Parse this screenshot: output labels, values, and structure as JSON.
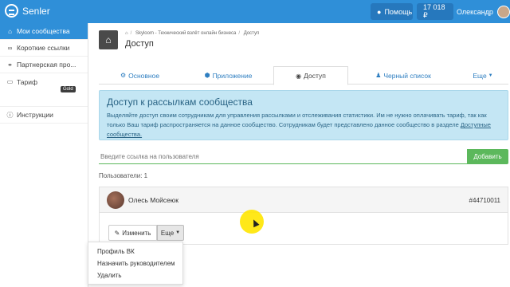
{
  "app": {
    "name": "Senler"
  },
  "topbar": {
    "help_label": "Помощь",
    "balance": "17 018 ₽",
    "user_name": "Олександр"
  },
  "sidebar": {
    "items": [
      {
        "label": "Мои сообщества",
        "icon": "home-icon"
      },
      {
        "label": "Короткие ссылки",
        "icon": "link-icon"
      },
      {
        "label": "Партнерская про...",
        "icon": "partner-icon"
      },
      {
        "label": "Тариф",
        "icon": "card-icon",
        "badge": "Gold"
      },
      {
        "label": "Инструкции",
        "icon": "info-icon"
      }
    ],
    "gold_badge": "Gold"
  },
  "header": {
    "breadcrumb": [
      "Skyloom - Технический взлёт онлайн бизнеса",
      "Доступ"
    ],
    "title": "Доступ"
  },
  "tabs": [
    {
      "label": "Основное",
      "icon": "gears-icon"
    },
    {
      "label": "Приложение",
      "icon": "cubes-icon"
    },
    {
      "label": "Доступ",
      "icon": "eye-icon"
    },
    {
      "label": "Черный список",
      "icon": "user-block-icon"
    },
    {
      "label": "Еще",
      "icon": "caret-down-icon"
    }
  ],
  "info": {
    "title": "Доступ к рассылкам сообщества",
    "text": "Выделяйте доступ своим сотрудникам для управления рассылками и отслеживания статистики. Им не нужно оплачивать тариф, так как только Ваш тариф распространяется на данное сообщество. Сотрудникам будет представлено данное сообщество в разделе ",
    "link": "Доступные сообщества."
  },
  "form": {
    "placeholder": "Введите ссылка на пользователя",
    "add_label": "Добавить"
  },
  "users": {
    "count_label": "Пользователи: 1",
    "items": [
      {
        "name": "Олесь Мойсеюк",
        "id": "#44710011"
      }
    ]
  },
  "actions": {
    "edit_label": "Изменить",
    "more_label": "Еще"
  },
  "dropdown": {
    "items": [
      "Профиль ВК",
      "Назначить руководителем",
      "Удалить"
    ]
  },
  "colors": {
    "primary": "#2f8fd8",
    "success": "#5cb85c",
    "info_bg": "#c4e6f4",
    "cursor_highlight": "#ffe600"
  }
}
